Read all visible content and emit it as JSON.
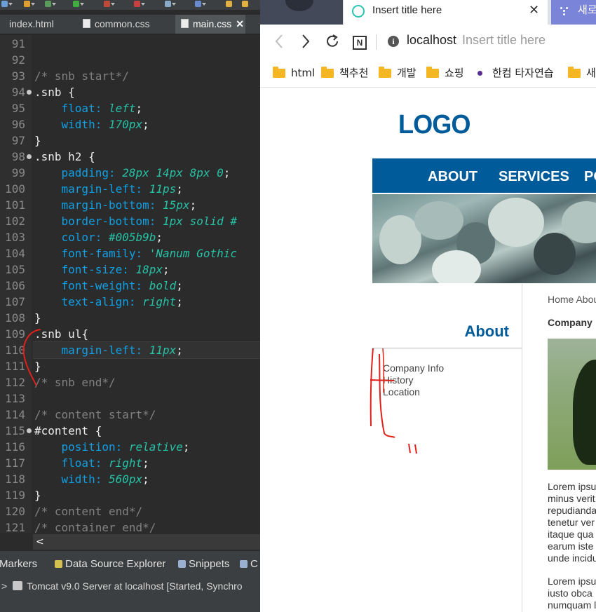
{
  "ide": {
    "tabs": [
      {
        "label": "index.html",
        "active": false
      },
      {
        "label": "common.css",
        "active": false
      },
      {
        "label": "main.css",
        "active": true,
        "close": "✕"
      }
    ],
    "lines": [
      {
        "n": "91",
        "fold": false,
        "tokens": []
      },
      {
        "n": "92",
        "fold": false,
        "tokens": []
      },
      {
        "n": "93",
        "fold": false,
        "tokens": [
          {
            "t": "/* snb start*/",
            "c": "c-comment"
          }
        ]
      },
      {
        "n": "94",
        "fold": true,
        "tokens": [
          {
            "t": ".snb",
            "c": "c-sel"
          },
          {
            "t": " {",
            "c": "c-plain"
          }
        ]
      },
      {
        "n": "95",
        "fold": false,
        "tokens": [
          {
            "t": "    float: ",
            "c": "c-prop"
          },
          {
            "t": "left",
            "c": "c-val"
          },
          {
            "t": ";",
            "c": "c-plain"
          }
        ]
      },
      {
        "n": "96",
        "fold": false,
        "tokens": [
          {
            "t": "    width: ",
            "c": "c-prop"
          },
          {
            "t": "170px",
            "c": "c-val"
          },
          {
            "t": ";",
            "c": "c-plain"
          }
        ]
      },
      {
        "n": "97",
        "fold": false,
        "tokens": [
          {
            "t": "}",
            "c": "c-plain"
          }
        ]
      },
      {
        "n": "98",
        "fold": true,
        "tokens": [
          {
            "t": ".snb h2",
            "c": "c-sel"
          },
          {
            "t": " {",
            "c": "c-plain"
          }
        ]
      },
      {
        "n": "99",
        "fold": false,
        "tokens": [
          {
            "t": "    padding: ",
            "c": "c-prop"
          },
          {
            "t": "28px 14px 8px 0",
            "c": "c-val"
          },
          {
            "t": ";",
            "c": "c-plain"
          }
        ]
      },
      {
        "n": "100",
        "fold": false,
        "tokens": [
          {
            "t": "    margin-left: ",
            "c": "c-prop"
          },
          {
            "t": "11ps",
            "c": "c-val"
          },
          {
            "t": ";",
            "c": "c-plain"
          }
        ]
      },
      {
        "n": "101",
        "fold": false,
        "tokens": [
          {
            "t": "    margin-bottom: ",
            "c": "c-prop"
          },
          {
            "t": "15px",
            "c": "c-val"
          },
          {
            "t": ";",
            "c": "c-plain"
          }
        ]
      },
      {
        "n": "102",
        "fold": false,
        "tokens": [
          {
            "t": "    border-bottom: ",
            "c": "c-prop"
          },
          {
            "t": "1px solid #",
            "c": "c-val"
          }
        ]
      },
      {
        "n": "103",
        "fold": false,
        "tokens": [
          {
            "t": "    color: ",
            "c": "c-prop"
          },
          {
            "t": "#005b9b",
            "c": "c-val"
          },
          {
            "t": ";",
            "c": "c-plain"
          }
        ]
      },
      {
        "n": "104",
        "fold": false,
        "tokens": [
          {
            "t": "    font-family: ",
            "c": "c-prop"
          },
          {
            "t": "'Nanum Gothic",
            "c": "c-val"
          }
        ]
      },
      {
        "n": "105",
        "fold": false,
        "tokens": [
          {
            "t": "    font-size: ",
            "c": "c-prop"
          },
          {
            "t": "18px",
            "c": "c-val"
          },
          {
            "t": ";",
            "c": "c-plain"
          }
        ]
      },
      {
        "n": "106",
        "fold": false,
        "tokens": [
          {
            "t": "    font-weight: ",
            "c": "c-prop"
          },
          {
            "t": "bold",
            "c": "c-val"
          },
          {
            "t": ";",
            "c": "c-plain"
          }
        ]
      },
      {
        "n": "107",
        "fold": false,
        "tokens": [
          {
            "t": "    text-align: ",
            "c": "c-prop"
          },
          {
            "t": "right",
            "c": "c-val"
          },
          {
            "t": ";",
            "c": "c-plain"
          }
        ]
      },
      {
        "n": "108",
        "fold": false,
        "tokens": [
          {
            "t": "}",
            "c": "c-plain"
          }
        ]
      },
      {
        "n": "109",
        "fold": false,
        "tokens": [
          {
            "t": ".snb ul",
            "c": "c-sel"
          },
          {
            "t": "{",
            "c": "c-plain"
          }
        ]
      },
      {
        "n": "110",
        "fold": false,
        "tokens": [
          {
            "t": "    margin-left: ",
            "c": "c-prop"
          },
          {
            "t": "11px",
            "c": "c-val"
          },
          {
            "t": ";",
            "c": "c-plain"
          }
        ]
      },
      {
        "n": "111",
        "fold": false,
        "tokens": [
          {
            "t": "}",
            "c": "c-plain"
          }
        ]
      },
      {
        "n": "112",
        "fold": false,
        "tokens": [
          {
            "t": "/* snb end*/",
            "c": "c-comment"
          }
        ]
      },
      {
        "n": "113",
        "fold": false,
        "tokens": []
      },
      {
        "n": "114",
        "fold": false,
        "tokens": [
          {
            "t": "/* content start*/",
            "c": "c-comment"
          }
        ]
      },
      {
        "n": "115",
        "fold": true,
        "tokens": [
          {
            "t": "#content",
            "c": "c-sel"
          },
          {
            "t": " {",
            "c": "c-plain"
          }
        ]
      },
      {
        "n": "116",
        "fold": false,
        "tokens": [
          {
            "t": "    position: ",
            "c": "c-prop"
          },
          {
            "t": "relative",
            "c": "c-val"
          },
          {
            "t": ";",
            "c": "c-plain"
          }
        ]
      },
      {
        "n": "117",
        "fold": false,
        "tokens": [
          {
            "t": "    float: ",
            "c": "c-prop"
          },
          {
            "t": "right",
            "c": "c-val"
          },
          {
            "t": ";",
            "c": "c-plain"
          }
        ]
      },
      {
        "n": "118",
        "fold": false,
        "tokens": [
          {
            "t": "    width: ",
            "c": "c-prop"
          },
          {
            "t": "560px",
            "c": "c-val"
          },
          {
            "t": ";",
            "c": "c-plain"
          }
        ]
      },
      {
        "n": "119",
        "fold": false,
        "tokens": [
          {
            "t": "}",
            "c": "c-plain"
          }
        ]
      },
      {
        "n": "120",
        "fold": false,
        "tokens": [
          {
            "t": "/* content end*/",
            "c": "c-comment"
          }
        ]
      },
      {
        "n": "121",
        "fold": false,
        "tokens": [
          {
            "t": "/* container end*/",
            "c": "c-comment"
          }
        ]
      }
    ],
    "scroll_left": "<",
    "bottom_tabs": [
      {
        "label": "Markers",
        "icon": "markers-icon",
        "color": "#c8a040"
      },
      {
        "label": "Data Source Explorer",
        "icon": "data-source-icon",
        "color": "#d4c050"
      },
      {
        "label": "Snippets",
        "icon": "snippets-icon",
        "color": "#9ab0d0"
      },
      {
        "label": "C",
        "icon": "console-icon",
        "color": "#9ab0d0"
      }
    ],
    "server_chevron": ">",
    "server_status": "Tomcat v9.0 Server at localhost  [Started, Synchro"
  },
  "browser": {
    "active_tab_title": "Insert title here",
    "close_glyph": "✕",
    "new_tab_label": "새로",
    "address_host": "localhost",
    "address_title": "Insert title here",
    "nav": {
      "back": "‹",
      "forward": "›",
      "reload": "↻",
      "n_button": "N"
    },
    "info": "i",
    "bookmarks": [
      {
        "label": "html",
        "type": "folder"
      },
      {
        "label": "책추천",
        "type": "folder"
      },
      {
        "label": "개발",
        "type": "folder"
      },
      {
        "label": "쇼핑",
        "type": "folder"
      },
      {
        "label": "한컴 타자연습",
        "type": "dot"
      },
      {
        "label": "새",
        "type": "folder"
      }
    ]
  },
  "page": {
    "logo": "LOGO",
    "gnb": [
      "ABOUT",
      "SERVICES",
      "PO"
    ],
    "snb_title": "About",
    "snb_items": [
      "Company Info",
      "History",
      "Location"
    ],
    "breadcrumb": "Home Abou",
    "content_title": "Company",
    "para1": "Lorem ipsu\nminus verit\nrepudianda\ntenetur ver\nitaque qua\nearum iste\nunde incidu",
    "para2": "Lorem ipsu\niusto obca\nnumquam l"
  },
  "colors": {
    "brand": "#005b9b",
    "ide_bg": "#2b2b2b",
    "annotation": "#e0201a"
  }
}
